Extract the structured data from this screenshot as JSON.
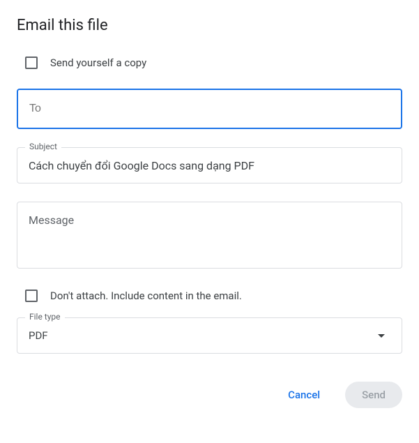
{
  "dialog": {
    "title": "Email this file"
  },
  "checkboxes": {
    "send_copy_label": "Send yourself a copy",
    "dont_attach_label": "Don't attach. Include content in the email."
  },
  "fields": {
    "to_placeholder": "To",
    "subject_label": "Subject",
    "subject_value": "Cách chuyển đổi Google Docs sang dạng PDF",
    "message_placeholder": "Message",
    "filetype_label": "File type",
    "filetype_value": "PDF"
  },
  "actions": {
    "cancel_label": "Cancel",
    "send_label": "Send"
  }
}
